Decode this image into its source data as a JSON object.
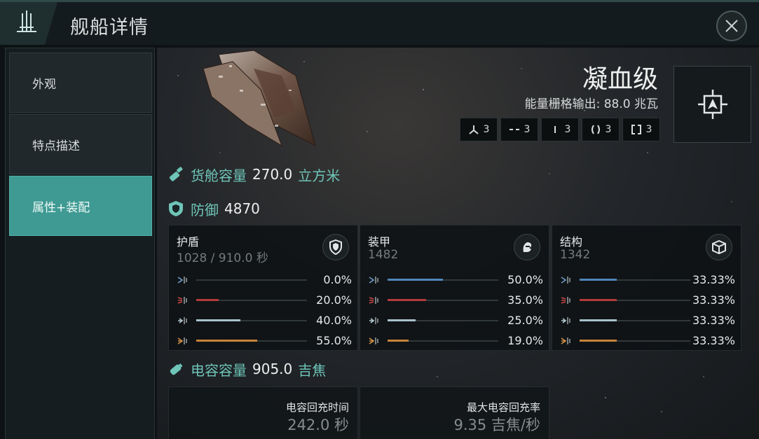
{
  "header": {
    "title": "舰船详情"
  },
  "sidebar": {
    "items": [
      {
        "label": "外观"
      },
      {
        "label": "特点描述"
      },
      {
        "label": "属性+装配"
      }
    ]
  },
  "ship": {
    "name": "凝血级",
    "power_label": "能量栅格输出:",
    "power_value": "88.0",
    "power_unit": "兆瓦",
    "slots": [
      {
        "icon": "high-slot-icon",
        "count": "3"
      },
      {
        "icon": "medium-slot-icon",
        "count": "3"
      },
      {
        "icon": "low-slot-icon",
        "count": "3"
      },
      {
        "icon": "rig-slot-icon",
        "count": "3"
      },
      {
        "icon": "subsystem-slot-icon",
        "count": "3"
      }
    ]
  },
  "cargo": {
    "label": "货舱容量",
    "value": "270.0",
    "unit": "立方米"
  },
  "defense": {
    "label": "防御",
    "value": "4870",
    "layers": [
      {
        "title": "护盾",
        "sub": "1028 / 910.0 秒",
        "icon": "shield-icon",
        "resists": [
          {
            "type": "em",
            "pct": "0.0%",
            "fraction": 0.0
          },
          {
            "type": "thermal",
            "pct": "20.0%",
            "fraction": 0.2
          },
          {
            "type": "kinetic",
            "pct": "40.0%",
            "fraction": 0.4
          },
          {
            "type": "explosive",
            "pct": "55.0%",
            "fraction": 0.55
          }
        ]
      },
      {
        "title": "装甲",
        "sub": "1482",
        "icon": "armor-icon",
        "resists": [
          {
            "type": "em",
            "pct": "50.0%",
            "fraction": 0.5
          },
          {
            "type": "thermal",
            "pct": "35.0%",
            "fraction": 0.35
          },
          {
            "type": "kinetic",
            "pct": "25.0%",
            "fraction": 0.25
          },
          {
            "type": "explosive",
            "pct": "19.0%",
            "fraction": 0.19
          }
        ]
      },
      {
        "title": "结构",
        "sub": "1342",
        "icon": "structure-icon",
        "resists": [
          {
            "type": "em",
            "pct": "33.33%",
            "fraction": 0.3333
          },
          {
            "type": "thermal",
            "pct": "33.33%",
            "fraction": 0.3333
          },
          {
            "type": "kinetic",
            "pct": "33.33%",
            "fraction": 0.3333
          },
          {
            "type": "explosive",
            "pct": "33.33%",
            "fraction": 0.3333
          }
        ]
      }
    ]
  },
  "capacitor": {
    "label": "电容容量",
    "value": "905.0",
    "unit": "吉焦",
    "recharge_time_label": "电容回充时间",
    "recharge_time_value": "242.0 秒",
    "peak_recharge_label": "最大电容回充率",
    "peak_recharge_value": "9.35 吉焦/秒"
  },
  "colors": {
    "accent": "#6ec5b8",
    "em": "#4f86b8",
    "thermal": "#b33a3a",
    "kinetic": "#a8c2cc",
    "explosive": "#c7843a"
  }
}
